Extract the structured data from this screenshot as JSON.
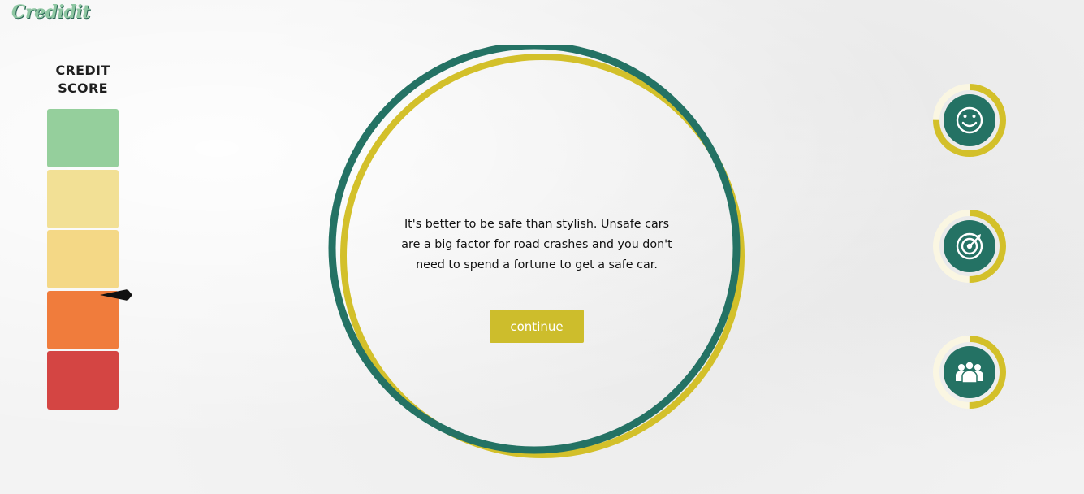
{
  "app": {
    "logo_text": "Credidit"
  },
  "credit_score": {
    "title_line1": "CREDIT",
    "title_line2": "SCORE",
    "segments": [
      {
        "color": "#95cf9c"
      },
      {
        "color": "#f2e095"
      },
      {
        "color": "#f4d886"
      },
      {
        "color": "#f07c3c"
      },
      {
        "color": "#d44543"
      }
    ]
  },
  "main": {
    "message": "It's better to be safe than stylish. Unsafe cars are a big factor for road crashes and you don't need to spend a fortune to get a safe car.",
    "continue_label": "continue"
  },
  "gauges": [
    {
      "icon": "smiley-icon",
      "level": 0.75
    },
    {
      "icon": "target-icon",
      "level": 0.5
    },
    {
      "icon": "people-icon",
      "level": 0.5
    }
  ],
  "colors": {
    "primary_teal": "#247264",
    "accent_yellow": "#d3c02a",
    "gauge_track": "#faf6e2"
  }
}
